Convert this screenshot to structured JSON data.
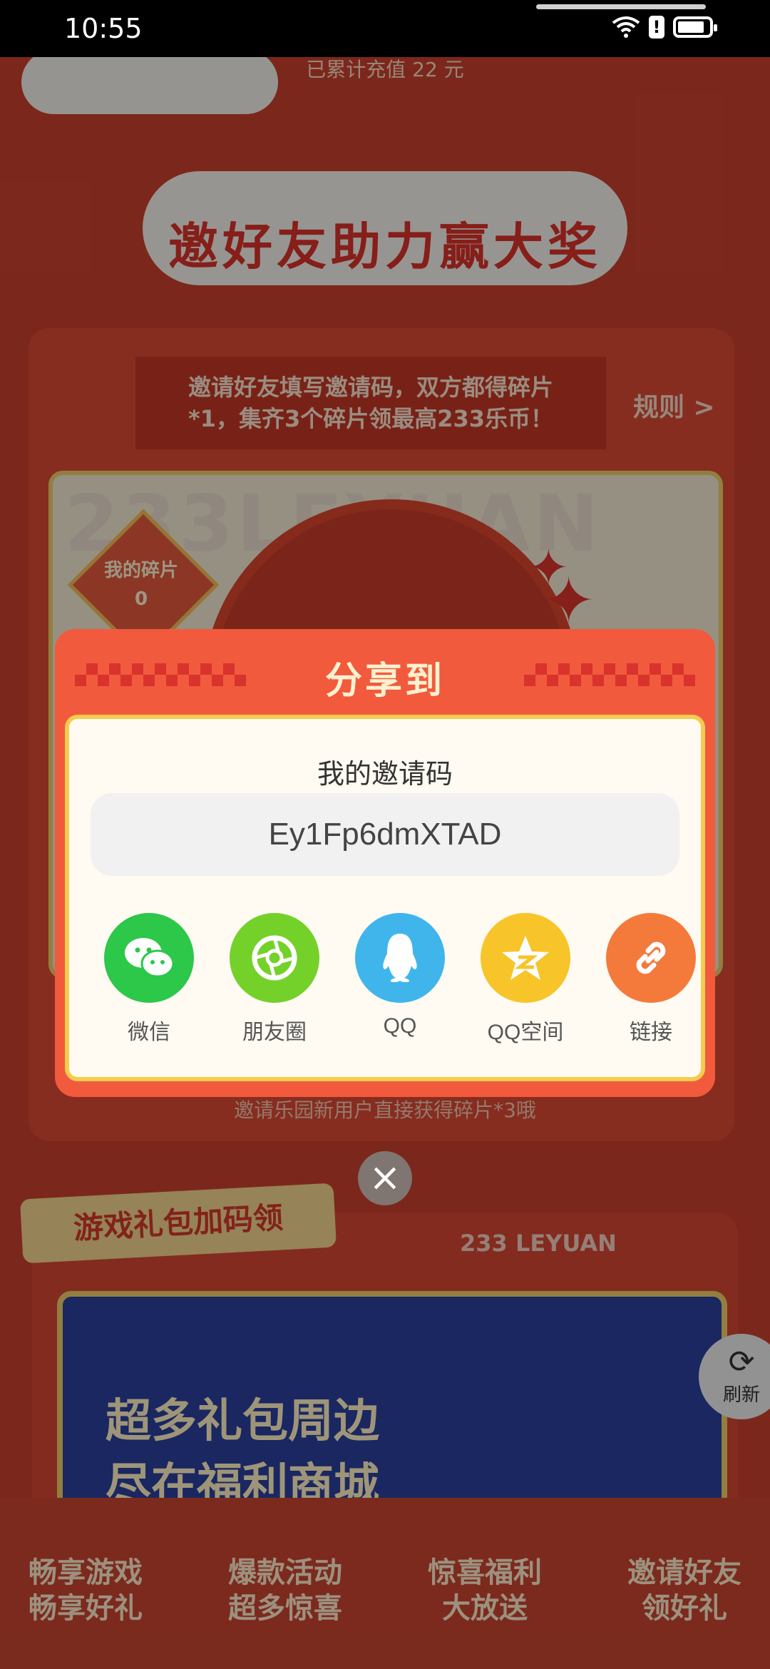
{
  "status_bar": {
    "time": "10:55"
  },
  "background": {
    "recharge_text": "已累计充值 22 元",
    "banner_title": "邀好友助力赢大奖",
    "hint_line1": "邀请好友填写邀请码，双方都得碎片",
    "hint_line2": "*1，集齐3个碎片领最高233乐币！",
    "rules_label": "规则 >",
    "watermark": "233LEYUAN",
    "my_fragments_label": "我的碎片",
    "my_fragments_count": "0",
    "invite_note": "邀请乐园新用户直接获得碎片*3哦",
    "gift_section_title": "游戏礼包加码领",
    "leyuan_label": "233 LEYUAN",
    "promo_line1": "超多礼包周边",
    "promo_line2": "尽在福利商城",
    "refresh_label": "刷新",
    "bottom_tabs": [
      {
        "line1": "畅享游戏",
        "line2": "畅享好礼"
      },
      {
        "line1": "爆款活动",
        "line2": "超多惊喜"
      },
      {
        "line1": "惊喜福利",
        "line2": "大放送"
      },
      {
        "line1": "邀请好友",
        "line2": "领好礼"
      }
    ]
  },
  "dialog": {
    "title": "分享到",
    "code_label": "我的邀请码",
    "invite_code": "Ey1Fp6dmXTAD",
    "share_targets": [
      {
        "label": "微信",
        "icon": "wechat-icon",
        "color": "#2dc74a"
      },
      {
        "label": "朋友圈",
        "icon": "moments-icon",
        "color": "#74d12a"
      },
      {
        "label": "QQ",
        "icon": "qq-icon",
        "color": "#3fb5ec"
      },
      {
        "label": "QQ空间",
        "icon": "qzone-icon",
        "color": "#f7c42a"
      },
      {
        "label": "链接",
        "icon": "link-icon",
        "color": "#f47a3c"
      }
    ],
    "close_icon": "close-icon"
  }
}
